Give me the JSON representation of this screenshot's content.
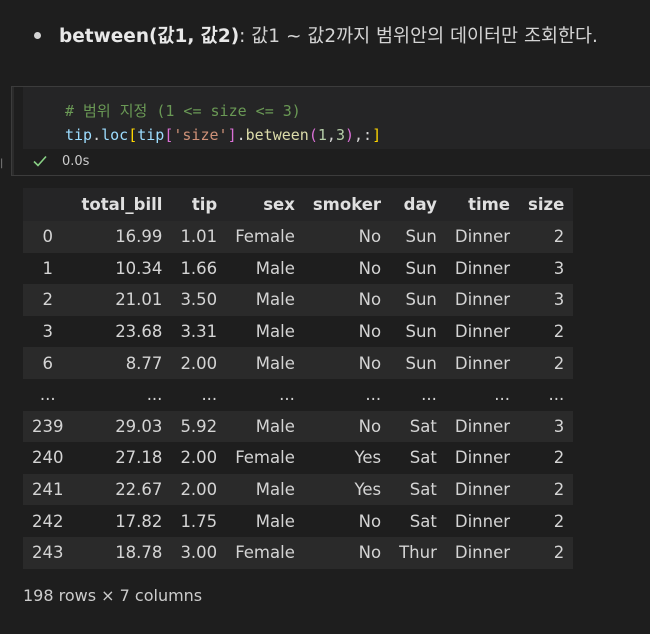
{
  "markdown": {
    "bold_text": "between(값1, 값2)",
    "rest_text": ": 값1 ~ 값2까지 범위안의 데이터만 조회한다."
  },
  "code": {
    "comment": "# 범위 지정 (1 <= size <= 3)",
    "line2": {
      "t1": "tip",
      "t2": ".",
      "t3": "loc",
      "t4": "[",
      "t5": "tip",
      "t6": "[",
      "t7": "'size'",
      "t8": "]",
      "t9": ".",
      "t10": "between",
      "t11": "(",
      "t12": "1",
      "t13": ",",
      "t14": "3",
      "t15": ")",
      "t16": ",:",
      "t17": "]"
    }
  },
  "status": {
    "time": "0.0s",
    "success_color": "#89d185"
  },
  "table": {
    "columns": [
      "",
      "total_bill",
      "tip",
      "sex",
      "smoker",
      "day",
      "time",
      "size"
    ],
    "rows": [
      [
        "0",
        "16.99",
        "1.01",
        "Female",
        "No",
        "Sun",
        "Dinner",
        "2"
      ],
      [
        "1",
        "10.34",
        "1.66",
        "Male",
        "No",
        "Sun",
        "Dinner",
        "3"
      ],
      [
        "2",
        "21.01",
        "3.50",
        "Male",
        "No",
        "Sun",
        "Dinner",
        "3"
      ],
      [
        "3",
        "23.68",
        "3.31",
        "Male",
        "No",
        "Sun",
        "Dinner",
        "2"
      ],
      [
        "6",
        "8.77",
        "2.00",
        "Male",
        "No",
        "Sun",
        "Dinner",
        "2"
      ],
      [
        "...",
        "...",
        "...",
        "...",
        "...",
        "...",
        "...",
        "..."
      ],
      [
        "239",
        "29.03",
        "5.92",
        "Male",
        "No",
        "Sat",
        "Dinner",
        "3"
      ],
      [
        "240",
        "27.18",
        "2.00",
        "Female",
        "Yes",
        "Sat",
        "Dinner",
        "2"
      ],
      [
        "241",
        "22.67",
        "2.00",
        "Male",
        "Yes",
        "Sat",
        "Dinner",
        "2"
      ],
      [
        "242",
        "17.82",
        "1.75",
        "Male",
        "No",
        "Sat",
        "Dinner",
        "2"
      ],
      [
        "243",
        "18.78",
        "3.00",
        "Female",
        "No",
        "Thur",
        "Dinner",
        "2"
      ]
    ]
  },
  "footer": "198 rows × 7 columns"
}
